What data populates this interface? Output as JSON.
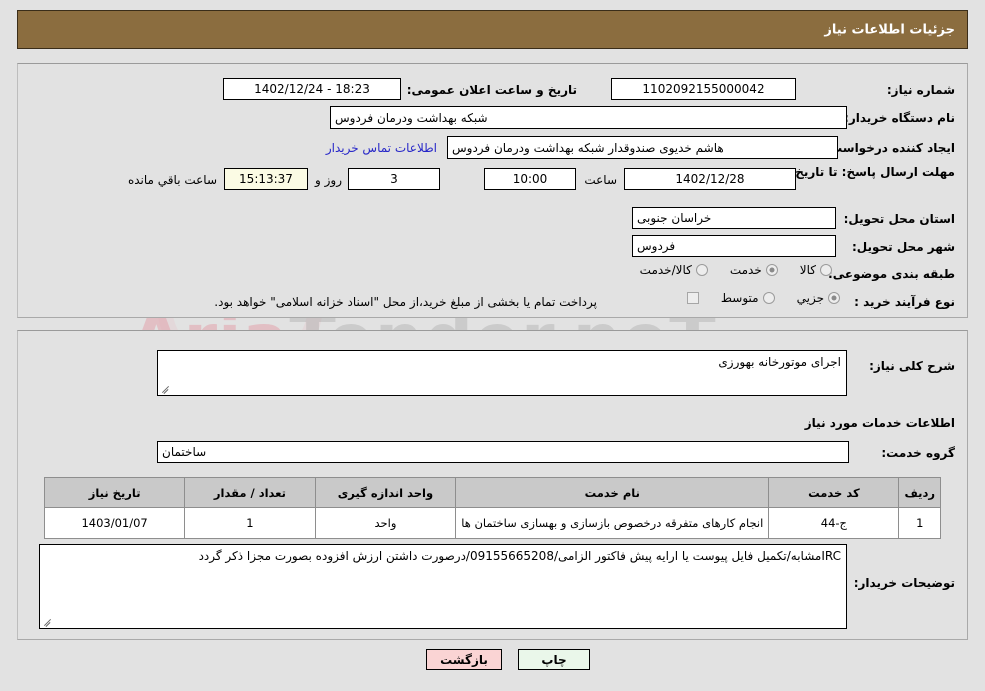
{
  "header": {
    "title": "جزئیات اطلاعات نیاز"
  },
  "watermark": {
    "text_left": "Aria",
    "text_right": "Tender.neT"
  },
  "top_panel": {
    "need_number": {
      "label": "شماره نیاز:",
      "value": "1102092155000042"
    },
    "announce_datetime": {
      "label": "تاریخ و ساعت اعلان عمومی:",
      "value": "1402/12/24 - 18:23"
    },
    "buyer_org": {
      "label": "نام دستگاه خریدار:",
      "value": "شبکه بهداشت ودرمان فردوس"
    },
    "requester": {
      "label": "ایجاد کننده درخواست:",
      "value": "هاشم خدیوی صندوقدار شبکه بهداشت ودرمان فردوس",
      "contact_link": "اطلاعات تماس خریدار"
    },
    "deadline": {
      "label": "مهلت ارسال پاسخ: تا تاریخ:",
      "date": "1402/12/28",
      "time_label": "ساعت",
      "time": "10:00",
      "days": "3",
      "days_label": "روز و",
      "countdown": "15:13:37",
      "remaining_label": "ساعت باقي مانده"
    },
    "province": {
      "label": "استان محل تحویل:",
      "value": "خراسان جنوبی"
    },
    "city": {
      "label": "شهر محل تحویل:",
      "value": "فردوس"
    },
    "category": {
      "label": "طبقه بندی موضوعی:",
      "options": [
        "کالا",
        "خدمت",
        "کالا/خدمت"
      ],
      "selected": "خدمت"
    },
    "purchase_type": {
      "label": "نوع فرآیند خرید :",
      "options": [
        "جزیي",
        "متوسط"
      ],
      "selected": "جزیي",
      "note": "پرداخت تمام یا بخشی از مبلغ خرید،از محل \"اسناد خزانه اسلامی\" خواهد بود."
    }
  },
  "bottom_panel": {
    "general_description": {
      "label": "شرح کلی نیاز:",
      "value": "اجرای موتورخانه بهورزی"
    },
    "services_section_title": "اطلاعات خدمات مورد نیاز",
    "service_group": {
      "label": "گروه خدمت:",
      "value": "ساختمان"
    },
    "table": {
      "columns": [
        "ردیف",
        "کد خدمت",
        "نام خدمت",
        "واحد اندازه گیری",
        "تعداد / مقدار",
        "تاریخ نیاز"
      ],
      "rows": [
        {
          "radif": "1",
          "code": "ج-44",
          "name": "انجام کارهای متفرقه درخصوص بازسازی و بهسازی ساختمان ها",
          "unit": "واحد",
          "quantity": "1",
          "date": "1403/01/07"
        }
      ]
    },
    "buyer_notes": {
      "label": "توضیحات خریدار:",
      "value": "IRCمشابه/تکمیل فایل پیوست یا ارایه پیش فاکتور الزامی/09155665208/درصورت داشتن ارزش افزوده بصورت مجزا ذکر گردد"
    }
  },
  "footer": {
    "back_button": "بازگشت",
    "print_button": "چاپ"
  },
  "colors": {
    "header_bg": "#8b6d3f",
    "page_bg": "#e2e2e2",
    "table_header_bg": "#c9c9c9",
    "link": "#2727c8",
    "timer_bg": "#fbfbe4",
    "back_button_bg": "#fad4d4",
    "print_button_bg": "#eaf7ea"
  }
}
